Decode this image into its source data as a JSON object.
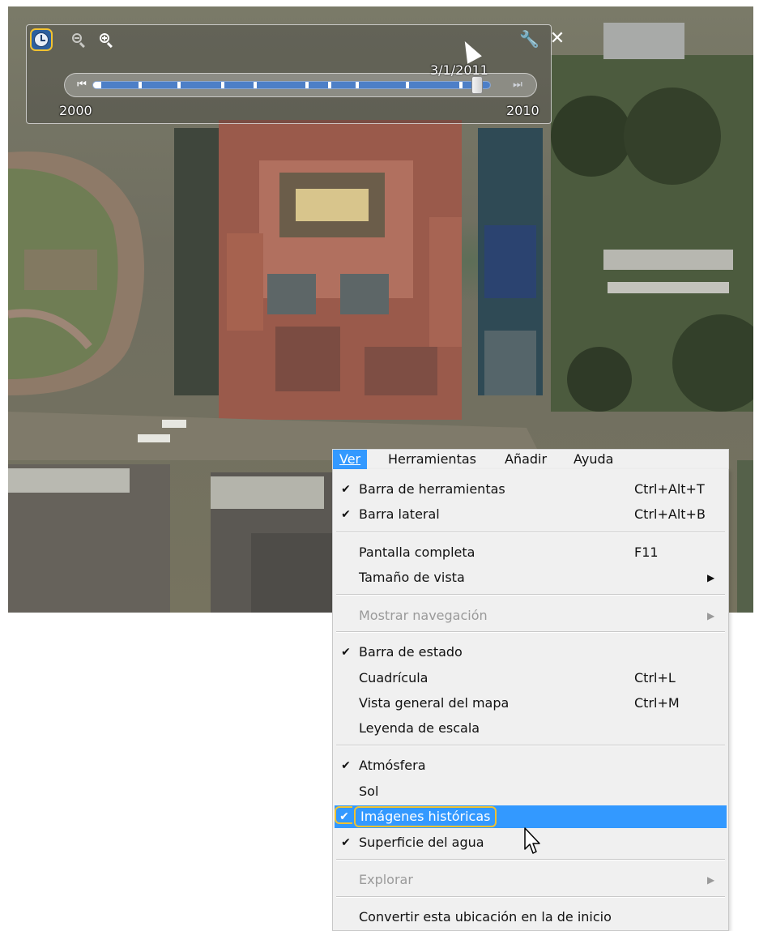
{
  "timebar": {
    "date": "3/1/2011",
    "year_start": "2000",
    "year_end": "2010",
    "slider_position": 0.98,
    "icons": {
      "historical": "clock-icon",
      "zoom_out": "zoom-out-icon",
      "zoom_in": "zoom-in-icon",
      "settings": "wrench-icon",
      "close": "close-icon",
      "prev": "skip-back-icon",
      "next": "skip-forward-icon"
    }
  },
  "menubar": {
    "ver": "Ver",
    "herramientas": "Herramientas",
    "anadir": "Añadir",
    "ayuda": "Ayuda"
  },
  "menu": {
    "barra_herramientas": {
      "label": "Barra de herramientas",
      "shortcut": "Ctrl+Alt+T",
      "checked": true
    },
    "barra_lateral": {
      "label": "Barra lateral",
      "shortcut": "Ctrl+Alt+B",
      "checked": true
    },
    "pantalla_completa": {
      "label": "Pantalla completa",
      "shortcut": "F11"
    },
    "tamano_vista": {
      "label": "Tamaño de vista",
      "submenu": true
    },
    "mostrar_navegacion": {
      "label": "Mostrar navegación",
      "disabled": true,
      "submenu": true
    },
    "barra_estado": {
      "label": "Barra de estado",
      "checked": true
    },
    "cuadricula": {
      "label": "Cuadrícula",
      "shortcut": "Ctrl+L"
    },
    "vista_general": {
      "label": "Vista general del mapa",
      "shortcut": "Ctrl+M"
    },
    "leyenda_escala": {
      "label": "Leyenda de escala"
    },
    "atmosfera": {
      "label": "Atmósfera",
      "checked": true
    },
    "sol": {
      "label": "Sol"
    },
    "imagenes_historicas": {
      "label": "Imágenes históricas",
      "checked": true,
      "highlighted": true
    },
    "superficie_agua": {
      "label": "Superficie del agua",
      "checked": true
    },
    "explorar": {
      "label": "Explorar",
      "disabled": true,
      "submenu": true
    },
    "convertir_inicio": {
      "label": "Convertir esta ubicación en la de inicio"
    }
  },
  "glyphs": {
    "check": "✔",
    "submenu_arrow": "▶"
  },
  "colors": {
    "highlight": "#3399ff",
    "callout": "#f2c230"
  }
}
